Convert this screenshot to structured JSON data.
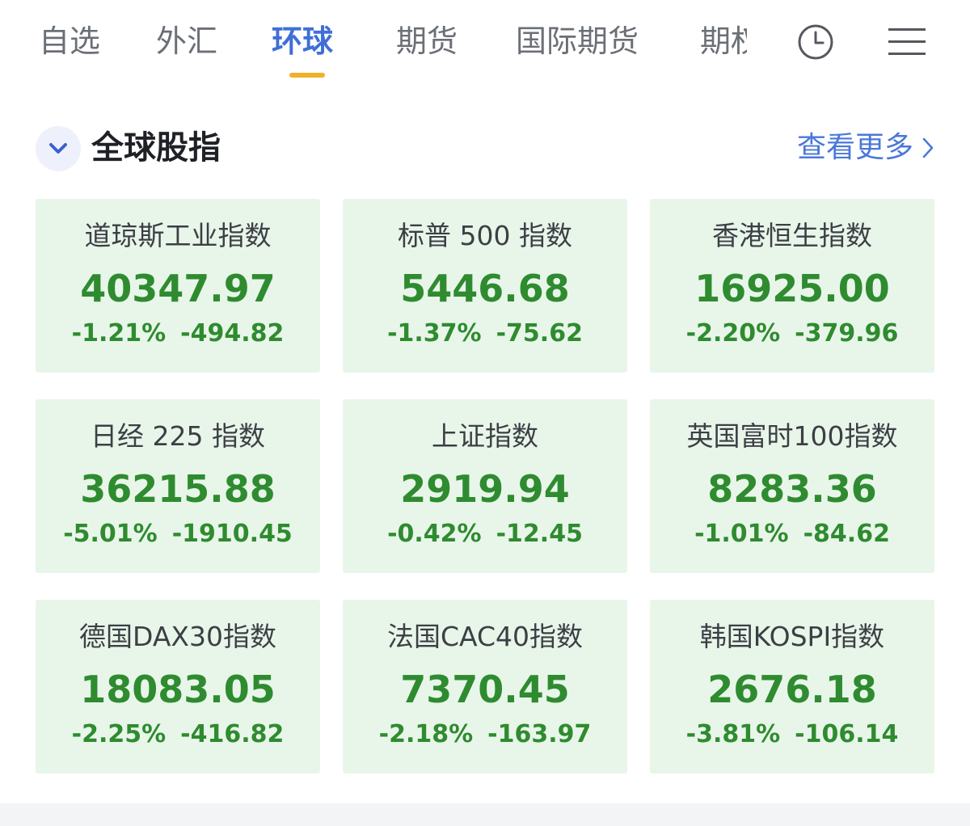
{
  "tabs": [
    {
      "label": "自选"
    },
    {
      "label": "外汇"
    },
    {
      "label": "环球"
    },
    {
      "label": "期货"
    },
    {
      "label": "国际期货"
    },
    {
      "label": "期权"
    }
  ],
  "active_tab_index": 2,
  "icons": {
    "history": "clock-icon",
    "menu": "hamburger-menu-icon",
    "collapse": "chevron-down-icon",
    "more": "chevron-right-icon"
  },
  "section": {
    "title": "全球股指",
    "more_label": "查看更多"
  },
  "indices": [
    {
      "name": "道琼斯工业指数",
      "price": "40347.97",
      "change_pct": "-1.21%",
      "change": "-494.82"
    },
    {
      "name": "标普 500 指数",
      "price": "5446.68",
      "change_pct": "-1.37%",
      "change": "-75.62"
    },
    {
      "name": "香港恒生指数",
      "price": "16925.00",
      "change_pct": "-2.20%",
      "change": "-379.96"
    },
    {
      "name": "日经 225 指数",
      "price": "36215.88",
      "change_pct": "-5.01%",
      "change": "-1910.45"
    },
    {
      "name": "上证指数",
      "price": "2919.94",
      "change_pct": "-0.42%",
      "change": "-12.45"
    },
    {
      "name": "英国富时100指数",
      "price": "8283.36",
      "change_pct": "-1.01%",
      "change": "-84.62"
    },
    {
      "name": "德国DAX30指数",
      "price": "18083.05",
      "change_pct": "-2.25%",
      "change": "-416.82"
    },
    {
      "name": "法国CAC40指数",
      "price": "7370.45",
      "change_pct": "-2.18%",
      "change": "-163.97"
    },
    {
      "name": "韩国KOSPI指数",
      "price": "2676.18",
      "change_pct": "-3.81%",
      "change": "-106.14"
    }
  ],
  "colors": {
    "active_tab": "#3f6fd6",
    "tab_underline": "#f0b028",
    "card_background": "#e8f6ea",
    "down_green": "#2f8b2f",
    "link_blue": "#4a78d8"
  }
}
